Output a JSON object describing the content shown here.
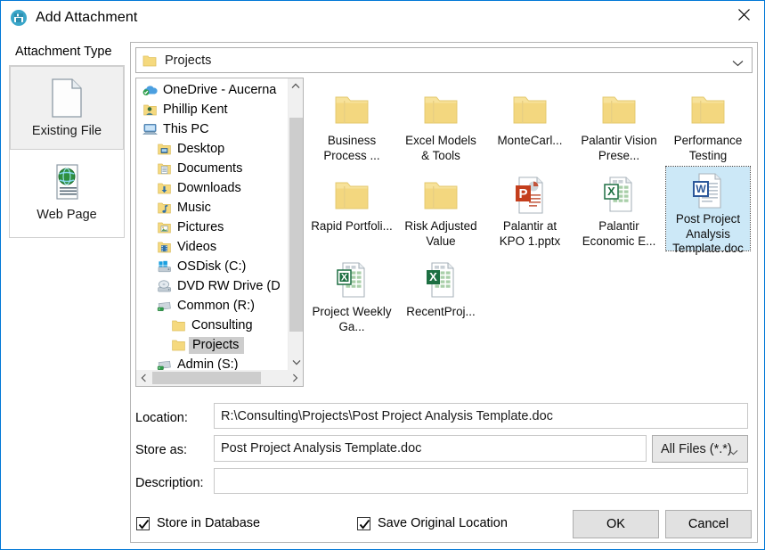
{
  "window": {
    "title": "Add Attachment",
    "title_icon": "attachment-window-icon",
    "close_label": "×",
    "accent": "#0078d7"
  },
  "attachment_type": {
    "group_label": "Attachment Type",
    "items": [
      {
        "label": "Existing File",
        "icon": "document-icon",
        "selected": true
      },
      {
        "label": "Web Page",
        "icon": "globe-page-icon",
        "selected": false
      }
    ]
  },
  "address_bar": {
    "path": "Projects",
    "icon": "folder-icon",
    "chevron": "chevron-down-icon"
  },
  "tree": {
    "nodes": [
      {
        "label": "OneDrive - Aucerna",
        "icon": "onedrive-icon",
        "depth": 0,
        "selected": false
      },
      {
        "label": "Phillip Kent",
        "icon": "user-folder-icon",
        "depth": 0,
        "selected": false
      },
      {
        "label": "This PC",
        "icon": "this-pc-icon",
        "depth": 0,
        "selected": false
      },
      {
        "label": "Desktop",
        "icon": "desktop-folder-icon",
        "depth": 1,
        "selected": false
      },
      {
        "label": "Documents",
        "icon": "documents-folder-icon",
        "depth": 1,
        "selected": false
      },
      {
        "label": "Downloads",
        "icon": "downloads-folder-icon",
        "depth": 1,
        "selected": false
      },
      {
        "label": "Music",
        "icon": "music-folder-icon",
        "depth": 1,
        "selected": false
      },
      {
        "label": "Pictures",
        "icon": "pictures-folder-icon",
        "depth": 1,
        "selected": false
      },
      {
        "label": "Videos",
        "icon": "videos-folder-icon",
        "depth": 1,
        "selected": false
      },
      {
        "label": "OSDisk (C:)",
        "icon": "windows-drive-icon",
        "depth": 1,
        "selected": false
      },
      {
        "label": "DVD RW Drive (D",
        "icon": "dvd-drive-icon",
        "depth": 1,
        "selected": false
      },
      {
        "label": "Common (R:)",
        "icon": "network-drive-icon",
        "depth": 1,
        "selected": false
      },
      {
        "label": "Consulting",
        "icon": "folder-icon",
        "depth": 2,
        "selected": false
      },
      {
        "label": "Projects",
        "icon": "folder-icon",
        "depth": 2,
        "selected": true
      },
      {
        "label": "Admin (S:)",
        "icon": "network-drive-icon",
        "depth": 1,
        "selected": false
      }
    ],
    "scroll_up": "chevron-up-icon",
    "scroll_down": "chevron-down-icon",
    "scroll_left": "chevron-left-icon",
    "scroll_right": "chevron-right-icon"
  },
  "files": [
    {
      "label": "Business Process ...",
      "type": "folder",
      "selected": false
    },
    {
      "label": "Excel Models & Tools",
      "type": "folder",
      "selected": false
    },
    {
      "label": "MonteCarl...",
      "type": "folder",
      "selected": false
    },
    {
      "label": "Palantir Vision Prese...",
      "type": "folder",
      "selected": false
    },
    {
      "label": "Performance Testing",
      "type": "folder",
      "selected": false
    },
    {
      "label": "Rapid Portfoli...",
      "type": "folder",
      "selected": false
    },
    {
      "label": "Risk Adjusted Value",
      "type": "folder",
      "selected": false
    },
    {
      "label": "Palantir at KPO 1.pptx",
      "type": "powerpoint",
      "selected": false
    },
    {
      "label": "Palantir Economic E...",
      "type": "excel",
      "selected": false
    },
    {
      "label": "Post Project Analysis Template.doc",
      "type": "word",
      "selected": true
    },
    {
      "label": "Project Weekly Ga...",
      "type": "excel",
      "selected": false
    },
    {
      "label": "RecentProj...",
      "type": "excel",
      "selected": false
    }
  ],
  "form": {
    "location_label": "Location:",
    "location_value": "R:\\Consulting\\Projects\\Post Project Analysis Template.doc",
    "store_as_label": "Store as:",
    "store_as_value": "Post Project Analysis Template.doc",
    "filter_value": "All Files (*.*)",
    "filter_chevron": "chevron-down-icon",
    "description_label": "Description:",
    "description_value": "",
    "description_placeholder": ""
  },
  "footer": {
    "checkboxes": [
      {
        "label": "Store in Database",
        "checked": true
      },
      {
        "label": "Save Original Location",
        "checked": true
      }
    ],
    "ok_label": "OK",
    "cancel_label": "Cancel"
  }
}
